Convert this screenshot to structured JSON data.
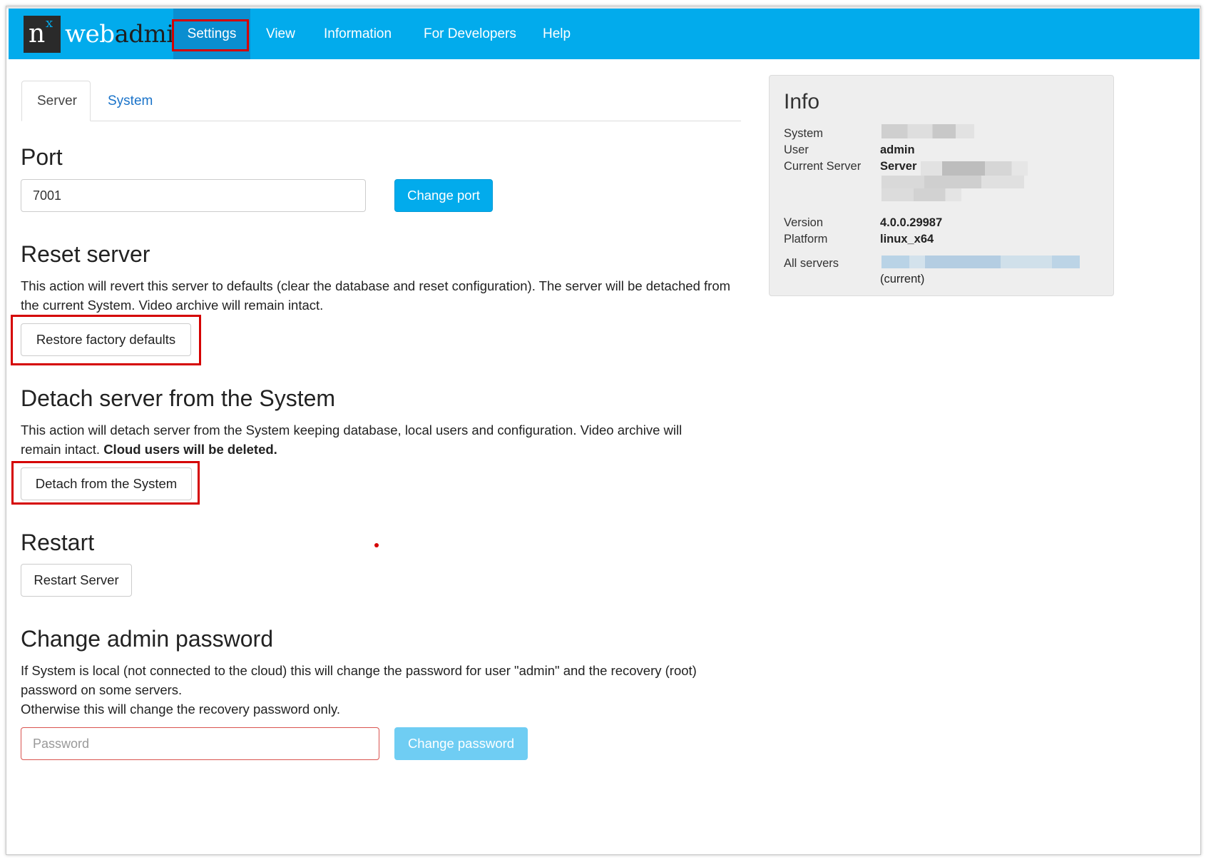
{
  "brand": {
    "logo_letter": "n",
    "logo_superscript": "x",
    "logo_text_light": "web",
    "logo_text_dark": "admin"
  },
  "nav": {
    "items": [
      {
        "label": "Settings",
        "active": true
      },
      {
        "label": "View"
      },
      {
        "label": "Information"
      },
      {
        "label": "For Developers"
      },
      {
        "label": "Help"
      }
    ]
  },
  "tabs": [
    {
      "label": "Server",
      "active": true
    },
    {
      "label": "System"
    }
  ],
  "port": {
    "heading": "Port",
    "value": "7001",
    "button": "Change port"
  },
  "reset": {
    "heading": "Reset server",
    "description": "This action will revert this server to defaults (clear the database and reset configuration). The server will be detached from the current System. Video archive will remain intact.",
    "button": "Restore factory defaults"
  },
  "detach": {
    "heading": "Detach server from the System",
    "description": "This action will detach server from the System keeping database, local users and configuration. Video archive will remain intact.",
    "description_bold": "Cloud users will be deleted.",
    "button": "Detach from the System"
  },
  "restart": {
    "heading": "Restart",
    "button": "Restart Server"
  },
  "password": {
    "heading": "Change admin password",
    "line1": "If System is local (not connected to the cloud) this will change the password for user \"admin\" and the recovery (root) password on some servers.",
    "line2": "Otherwise this will change the recovery password only.",
    "placeholder": "Password",
    "button": "Change password"
  },
  "info": {
    "title": "Info",
    "system_label": "System",
    "user_label": "User",
    "user_value": "admin",
    "server_label": "Current Server",
    "server_value": "Server",
    "version_label": "Version",
    "version_value": "4.0.0.29987",
    "platform_label": "Platform",
    "platform_value": "linux_x64",
    "all_servers_label": "All servers",
    "all_servers_note": "(current)"
  },
  "colors": {
    "navbar": "#02abec",
    "highlight": "#d50000",
    "link": "#1a73c9"
  }
}
